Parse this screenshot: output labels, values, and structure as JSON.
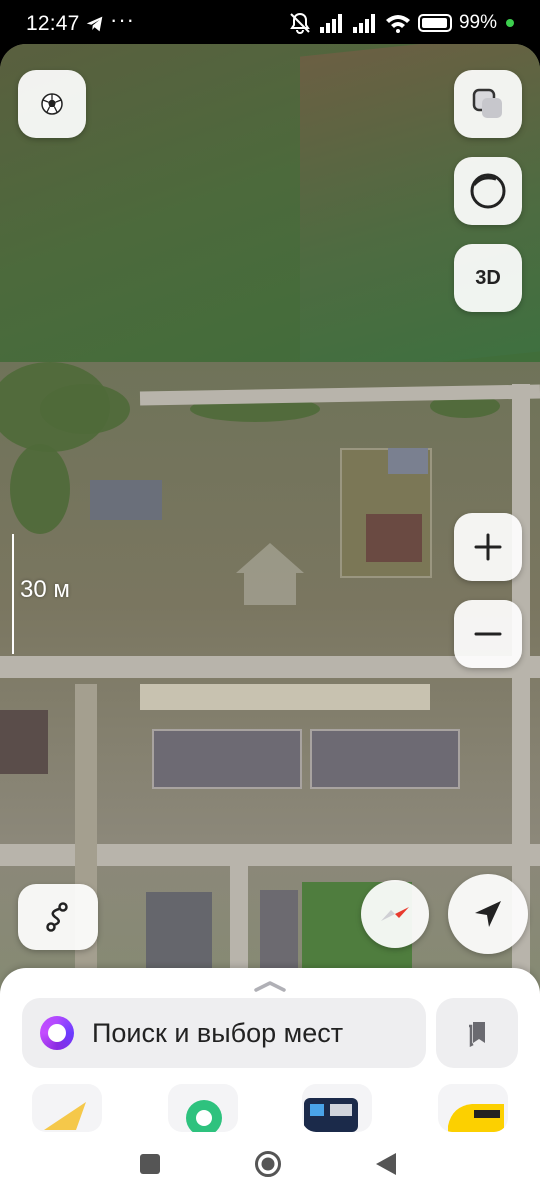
{
  "status_bar": {
    "time": "12:47",
    "dots": "···",
    "battery_text": "99%",
    "battery_level": 0.99
  },
  "map": {
    "scale_label": "30 м",
    "buttons": {
      "sport_icon": "soccer-ball-icon",
      "layers_icon": "layers-icon",
      "camera_icon": "camera-mode-icon",
      "three_d_label": "3D",
      "zoom_in_icon": "plus-icon",
      "zoom_out_icon": "minus-icon",
      "route_icon": "route-icon",
      "compass_icon": "compass-icon",
      "locate_icon": "location-arrow-icon"
    }
  },
  "sheet": {
    "search_placeholder": "Поиск и выбор мест",
    "bookmarks_icon": "bookmarks-icon",
    "quick_actions": [
      "navigator-app",
      "services-app",
      "transport-app",
      "taxi-app"
    ]
  },
  "navbar": {
    "buttons": [
      "recents",
      "home",
      "back"
    ]
  },
  "colors": {
    "accent_alice": "#8a2be2",
    "status_green": "#3ccf4e"
  }
}
